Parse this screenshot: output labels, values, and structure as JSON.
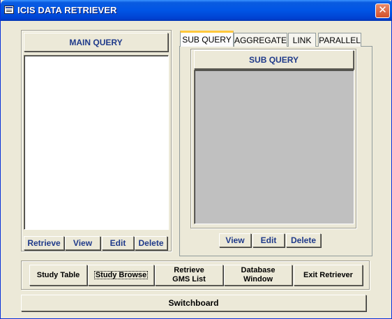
{
  "window": {
    "title": "ICIS DATA RETRIEVER",
    "close_label": "✕"
  },
  "main_query": {
    "header": "MAIN QUERY",
    "buttons": {
      "retrieve": "Retrieve",
      "view": "View",
      "edit": "Edit",
      "delete": "Delete"
    }
  },
  "tabs": [
    {
      "label": "SUB QUERY",
      "active": true
    },
    {
      "label": "AGGREGATE",
      "active": false
    },
    {
      "label": "LINK",
      "active": false
    },
    {
      "label": "PARALLEL",
      "active": false
    }
  ],
  "sub_query": {
    "header": "SUB QUERY",
    "buttons": {
      "view": "View",
      "edit": "Edit",
      "delete": "Delete"
    }
  },
  "bottom_bar": {
    "study_table": "Study Table",
    "study_browse": "Study Browse",
    "retrieve_gms_list": "Retrieve GMS List",
    "database_window": "Database Window",
    "exit_retriever": "Exit Retriever"
  },
  "switchboard": "Switchboard",
  "colors": {
    "titlebar": "#0055E5",
    "button_text": "#1F3A8A",
    "face": "#ECE9D8",
    "close": "#D2502A"
  }
}
